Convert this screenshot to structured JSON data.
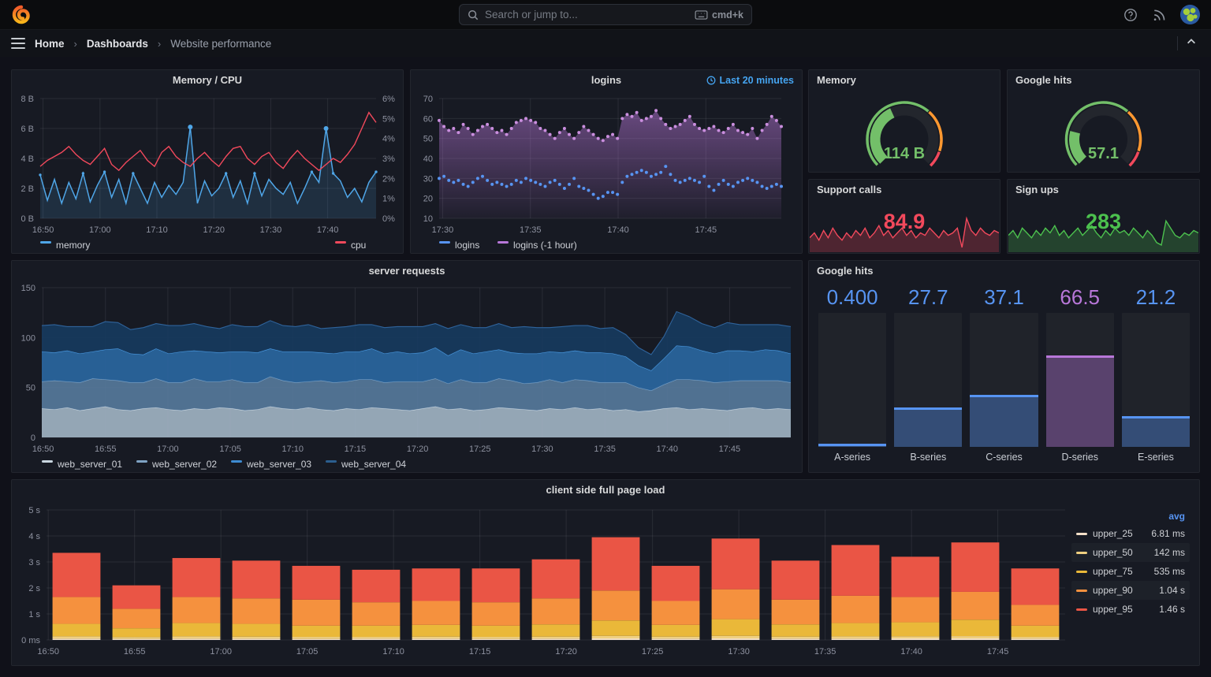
{
  "nav": {
    "search_placeholder": "Search or jump to...",
    "shortcut": "cmd+k"
  },
  "breadcrumb": {
    "home": "Home",
    "dashboards": "Dashboards",
    "current": "Website performance"
  },
  "panels": {
    "memcpu": {
      "title": "Memory / CPU"
    },
    "logins": {
      "title": "logins",
      "time_note": "Last 20 minutes"
    },
    "gauge_memory": {
      "title": "Memory"
    },
    "gauge_google": {
      "title": "Google hits"
    },
    "support": {
      "title": "Support calls"
    },
    "signups": {
      "title": "Sign ups"
    },
    "serverreq": {
      "title": "server requests"
    },
    "bargauge": {
      "title": "Google hits"
    },
    "pageload": {
      "title": "client side full page load"
    }
  },
  "chart_data": [
    {
      "id": "memcpu",
      "type": "line",
      "title": "Memory / CPU",
      "x_ticks": [
        "16:50",
        "17:00",
        "17:10",
        "17:20",
        "17:30",
        "17:40"
      ],
      "left_axis": {
        "ticks": [
          "8 B",
          "6 B",
          "4 B",
          "2 B",
          "0 B"
        ],
        "max": 8
      },
      "right_axis": {
        "ticks": [
          "6%",
          "5%",
          "4%",
          "3%",
          "2%",
          "1%",
          "0%"
        ],
        "max": 6
      },
      "series": [
        {
          "name": "memory",
          "color": "#4FA6E8",
          "axis": "left",
          "values": [
            2.9,
            1.2,
            2.6,
            1.0,
            2.4,
            1.3,
            3.0,
            1.1,
            2.2,
            3.1,
            1.4,
            2.6,
            1.0,
            3.0,
            2.0,
            1.0,
            2.4,
            1.4,
            2.2,
            1.6,
            2.4,
            6.1,
            1.0,
            2.5,
            1.5,
            2.0,
            3.0,
            1.4,
            2.5,
            1.0,
            3.0,
            1.5,
            2.6,
            2.0,
            1.6,
            2.4,
            1.0,
            2.0,
            3.1,
            2.4,
            6.0,
            3.0,
            2.5,
            1.4,
            2.0,
            1.1,
            2.4,
            3.1
          ]
        },
        {
          "name": "cpu",
          "color": "#F2495C",
          "axis": "right",
          "values": [
            2.6,
            2.9,
            3.1,
            3.3,
            3.6,
            3.2,
            2.9,
            2.7,
            3.1,
            3.5,
            2.7,
            2.4,
            2.8,
            3.1,
            3.4,
            2.9,
            2.6,
            3.3,
            3.6,
            3.1,
            2.8,
            2.6,
            3.0,
            3.3,
            2.9,
            2.6,
            3.1,
            3.5,
            3.6,
            3.0,
            2.7,
            3.1,
            3.3,
            2.8,
            2.5,
            3.0,
            3.4,
            3.0,
            2.7,
            2.4,
            2.7,
            3.0,
            2.8,
            3.2,
            3.7,
            4.5,
            5.3,
            4.8
          ]
        }
      ]
    },
    {
      "id": "logins",
      "type": "scatter",
      "title": "logins",
      "time_note": "Last 20 minutes",
      "x_ticks": [
        "17:30",
        "17:35",
        "17:40",
        "17:45"
      ],
      "y_ticks": [
        "70",
        "60",
        "50",
        "40",
        "30",
        "20",
        "10"
      ],
      "ylim": [
        10,
        70
      ],
      "series": [
        {
          "name": "logins (-1 hour)",
          "color": "#B877D9",
          "dot": "#CA8EDE",
          "area": true,
          "values": [
            59,
            56,
            54,
            55,
            53,
            57,
            55,
            52,
            54,
            56,
            57,
            55,
            53,
            54,
            52,
            55,
            58,
            59,
            60,
            59,
            58,
            55,
            54,
            52,
            50,
            53,
            55,
            52,
            50,
            53,
            56,
            54,
            52,
            50,
            49,
            51,
            52,
            50,
            60,
            62,
            61,
            63,
            59,
            60,
            61,
            64,
            60,
            57,
            55,
            56,
            57,
            59,
            61,
            57,
            55,
            54,
            55,
            56,
            54,
            53,
            55,
            57,
            54,
            53,
            52,
            55,
            50,
            54,
            57,
            61,
            59,
            56
          ]
        },
        {
          "name": "logins",
          "color": "#5794F2",
          "dot": "#5794F2",
          "area": false,
          "values": [
            30,
            31,
            29,
            28,
            29,
            27,
            26,
            28,
            30,
            31,
            29,
            27,
            28,
            27,
            26,
            27,
            29,
            28,
            30,
            29,
            28,
            27,
            26,
            28,
            29,
            27,
            25,
            27,
            30,
            26,
            25,
            24,
            22,
            20,
            21,
            23,
            23,
            22,
            28,
            31,
            32,
            33,
            34,
            33,
            31,
            32,
            33,
            36,
            32,
            29,
            28,
            29,
            30,
            29,
            28,
            31,
            26,
            24,
            27,
            29,
            27,
            26,
            28,
            29,
            30,
            29,
            28,
            26,
            25,
            26,
            27,
            26
          ]
        }
      ],
      "legend_order": [
        "logins",
        "logins (-1 hour)"
      ]
    },
    {
      "id": "gauge_memory",
      "type": "gauge",
      "title": "Memory",
      "value_text": "114 B",
      "percent": 41,
      "color": "#73BF69",
      "thresholds": [
        {
          "color": "#73BF69",
          "upto": 65
        },
        {
          "color": "#FF9830",
          "upto": 90
        },
        {
          "color": "#F2495C",
          "upto": 100
        }
      ]
    },
    {
      "id": "gauge_google",
      "type": "gauge",
      "title": "Google hits",
      "value_text": "57.1",
      "percent": 22,
      "color": "#73BF69",
      "thresholds": [
        {
          "color": "#73BF69",
          "upto": 65
        },
        {
          "color": "#FF9830",
          "upto": 90
        },
        {
          "color": "#F2495C",
          "upto": 100
        }
      ]
    },
    {
      "id": "support",
      "type": "sparkline",
      "title": "Support calls",
      "value_text": "84.9",
      "color": "#F2495C",
      "max": 15,
      "values": [
        5,
        7,
        4,
        8,
        5,
        9,
        6,
        4,
        7,
        5,
        8,
        6,
        9,
        5,
        7,
        10,
        6,
        8,
        5,
        7,
        9,
        6,
        8,
        5,
        7,
        6,
        9,
        7,
        5,
        8,
        6,
        7,
        9,
        1,
        13,
        8,
        6,
        9,
        7,
        6,
        8,
        7
      ]
    },
    {
      "id": "signups",
      "type": "sparkline",
      "title": "Sign ups",
      "value_text": "283",
      "color": "#4CC14E",
      "max": 15,
      "values": [
        6,
        8,
        5,
        9,
        7,
        5,
        8,
        6,
        9,
        7,
        10,
        6,
        8,
        5,
        7,
        9,
        6,
        8,
        10,
        7,
        5,
        8,
        6,
        9,
        7,
        8,
        6,
        9,
        7,
        5,
        8,
        6,
        3,
        2,
        12,
        9,
        6,
        5,
        7,
        6,
        8,
        7
      ]
    },
    {
      "id": "serverreq",
      "type": "stacked_area",
      "title": "server requests",
      "y_ticks": [
        "0",
        "50",
        "100",
        "150"
      ],
      "ylim": [
        0,
        150
      ],
      "x_ticks": [
        "16:50",
        "16:55",
        "17:00",
        "17:05",
        "17:10",
        "17:15",
        "17:20",
        "17:25",
        "17:30",
        "17:35",
        "17:40",
        "17:45"
      ],
      "series": [
        {
          "name": "web_server_01",
          "fill": "#9FB2C2",
          "stroke": "#C9D6E0",
          "legend": "#C9D6E0",
          "values": [
            29,
            28,
            30,
            27,
            29,
            31,
            28,
            27,
            29,
            30,
            28,
            27,
            29,
            28,
            30,
            29,
            27,
            28,
            31,
            29,
            28,
            30,
            28,
            27,
            29,
            28,
            30,
            29,
            28,
            27,
            29,
            31,
            28,
            29,
            27,
            28,
            30,
            29,
            28,
            27,
            29,
            28,
            30,
            28,
            29,
            27,
            28,
            26,
            27,
            29,
            30,
            28,
            29,
            28,
            27,
            29,
            30,
            28,
            29,
            28
          ]
        },
        {
          "name": "web_server_02",
          "fill": "#56789B",
          "stroke": "#7FA3C4",
          "legend": "#7FA3C4",
          "values": [
            27,
            29,
            26,
            28,
            30,
            27,
            29,
            28,
            26,
            29,
            27,
            28,
            30,
            28,
            26,
            29,
            28,
            27,
            30,
            28,
            27,
            26,
            29,
            28,
            27,
            30,
            28,
            26,
            28,
            29,
            27,
            28,
            26,
            29,
            28,
            27,
            29,
            28,
            26,
            28,
            29,
            27,
            28,
            29,
            26,
            28,
            27,
            24,
            20,
            24,
            28,
            30,
            28,
            27,
            29,
            28,
            27,
            29,
            28,
            27
          ]
        },
        {
          "name": "web_server_03",
          "fill": "#2A66A0",
          "stroke": "#4D9FE8",
          "legend": "#3E8BD1",
          "values": [
            30,
            28,
            31,
            29,
            27,
            30,
            32,
            29,
            28,
            30,
            29,
            31,
            28,
            30,
            29,
            28,
            31,
            30,
            28,
            29,
            31,
            30,
            28,
            29,
            30,
            28,
            31,
            29,
            30,
            28,
            29,
            31,
            28,
            30,
            29,
            31,
            29,
            28,
            30,
            29,
            28,
            30,
            29,
            28,
            30,
            29,
            26,
            22,
            20,
            26,
            34,
            33,
            30,
            29,
            31,
            30,
            29,
            31,
            30,
            29
          ]
        },
        {
          "name": "web_server_04",
          "fill": "#17395E",
          "stroke": "#2F639B",
          "legend": "#2B5E8F",
          "values": [
            26,
            28,
            24,
            27,
            25,
            28,
            26,
            24,
            27,
            25,
            28,
            26,
            27,
            25,
            24,
            27,
            25,
            26,
            28,
            26,
            25,
            27,
            24,
            26,
            25,
            27,
            24,
            26,
            25,
            27,
            26,
            24,
            27,
            25,
            26,
            24,
            26,
            25,
            27,
            26,
            24,
            26,
            25,
            27,
            24,
            26,
            22,
            18,
            16,
            22,
            34,
            30,
            27,
            26,
            28,
            26,
            27,
            25,
            26,
            27
          ]
        }
      ]
    },
    {
      "id": "bargauge",
      "type": "bar_gauge",
      "title": "Google hits",
      "max": 100,
      "items": [
        {
          "label": "A-series",
          "value_text": "0.400",
          "value": 0.4,
          "color": "#5794F2"
        },
        {
          "label": "B-series",
          "value_text": "27.7",
          "value": 27.7,
          "color": "#5794F2"
        },
        {
          "label": "C-series",
          "value_text": "37.1",
          "value": 37.1,
          "color": "#5794F2"
        },
        {
          "label": "D-series",
          "value_text": "66.5",
          "value": 66.5,
          "color": "#B877D9"
        },
        {
          "label": "E-series",
          "value_text": "21.2",
          "value": 21.2,
          "color": "#5794F2"
        }
      ]
    },
    {
      "id": "pageload",
      "type": "stacked_bar",
      "title": "client side full page load",
      "y_ticks": [
        "0 ms",
        "1 s",
        "2 s",
        "3 s",
        "4 s",
        "5 s"
      ],
      "ylim": [
        0,
        5
      ],
      "x_ticks": [
        "16:50",
        "16:55",
        "17:00",
        "17:05",
        "17:10",
        "17:15",
        "17:20",
        "17:25",
        "17:30",
        "17:35",
        "17:40",
        "17:45"
      ],
      "order": [
        "upper_25",
        "upper_50",
        "upper_75",
        "upper_90",
        "upper_95"
      ],
      "colors": {
        "upper_25": "#F4E0C8",
        "upper_50": "#F0D080",
        "upper_75": "#EAB839",
        "upper_90": "#F5913E",
        "upper_95": "#EA5545"
      },
      "stacks": {
        "upper_25": [
          0.05,
          0.04,
          0.05,
          0.05,
          0.04,
          0.05,
          0.05,
          0.04,
          0.05,
          0.06,
          0.05,
          0.06,
          0.05,
          0.05,
          0.06,
          0.06,
          0.05
        ],
        "upper_50": [
          0.14,
          0.11,
          0.14,
          0.13,
          0.12,
          0.12,
          0.13,
          0.12,
          0.13,
          0.16,
          0.13,
          0.16,
          0.13,
          0.14,
          0.14,
          0.15,
          0.12
        ],
        "upper_75": [
          0.62,
          0.45,
          0.65,
          0.62,
          0.55,
          0.55,
          0.58,
          0.55,
          0.6,
          0.75,
          0.58,
          0.8,
          0.6,
          0.65,
          0.68,
          0.78,
          0.55
        ],
        "upper_90": [
          1.65,
          1.2,
          1.65,
          1.6,
          1.55,
          1.45,
          1.5,
          1.45,
          1.6,
          1.9,
          1.5,
          1.95,
          1.55,
          1.7,
          1.65,
          1.85,
          1.35
        ],
        "upper_95": [
          3.35,
          2.1,
          3.15,
          3.05,
          2.85,
          2.7,
          2.75,
          2.75,
          3.1,
          3.95,
          2.85,
          3.9,
          3.05,
          3.65,
          3.2,
          3.75,
          2.75
        ]
      },
      "legend": {
        "header": "avg",
        "rows": [
          {
            "name": "upper_25",
            "avg": "6.81 ms"
          },
          {
            "name": "upper_50",
            "avg": "142 ms"
          },
          {
            "name": "upper_75",
            "avg": "535 ms"
          },
          {
            "name": "upper_90",
            "avg": "1.04 s"
          },
          {
            "name": "upper_95",
            "avg": "1.46 s"
          }
        ]
      }
    }
  ]
}
